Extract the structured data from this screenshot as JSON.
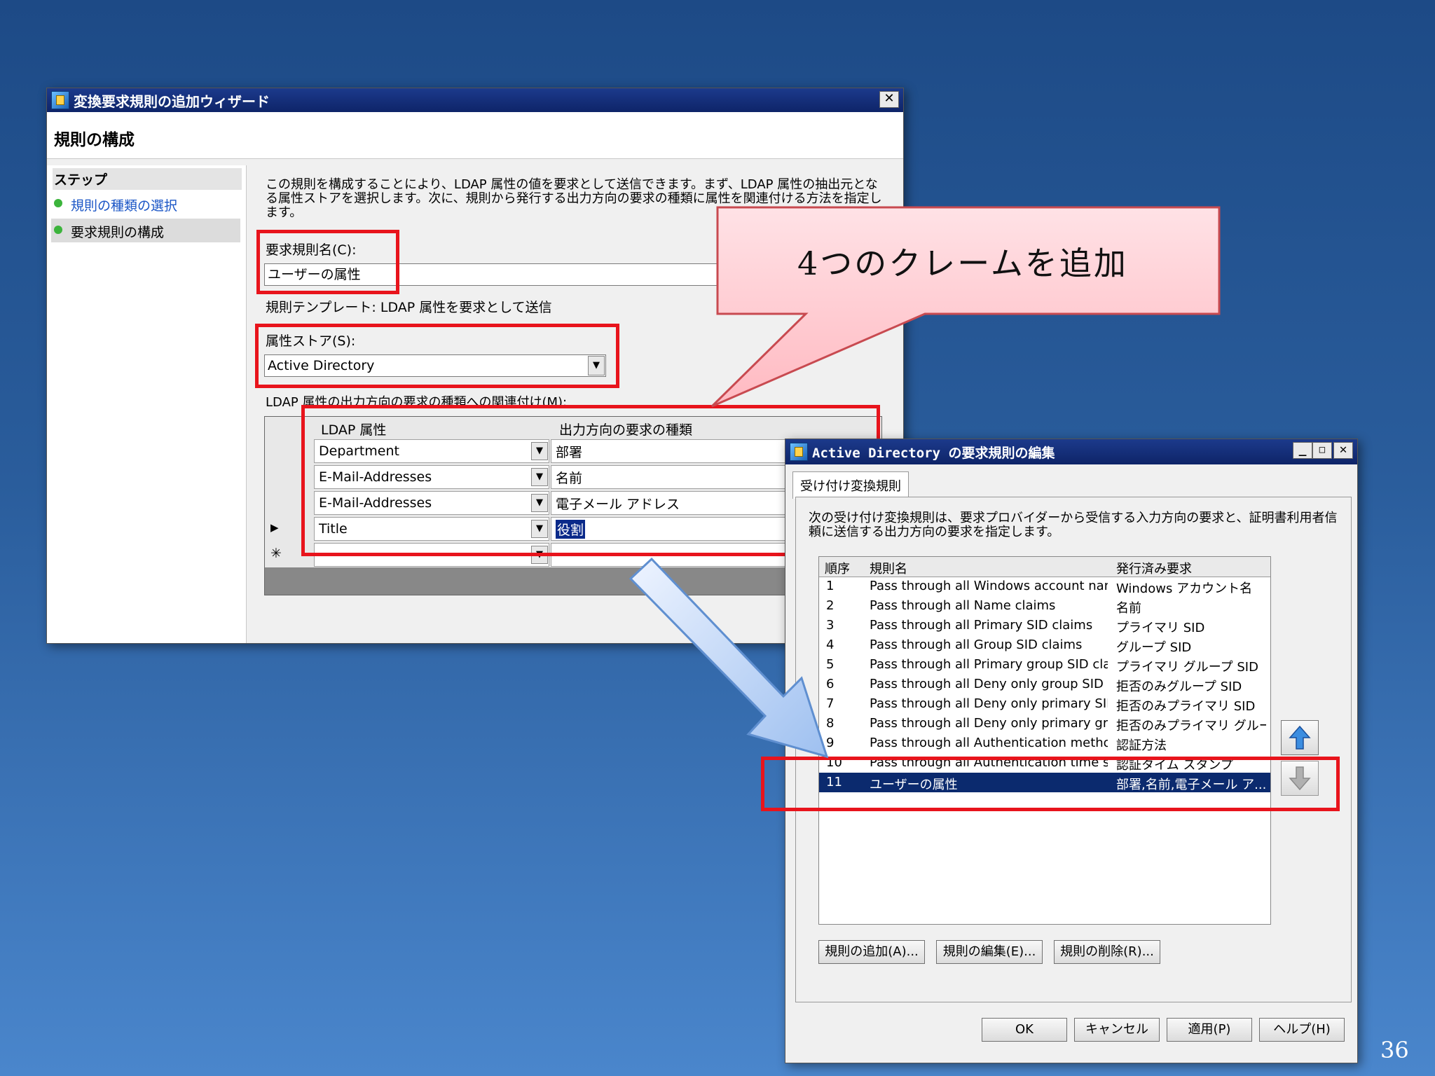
{
  "wizard": {
    "title": "変換要求規則の追加ウィザード",
    "heading": "規則の構成",
    "steps_label": "ステップ",
    "steps": [
      "規則の種類の選択",
      "要求規則の構成"
    ],
    "description": "この規則を構成することにより、LDAP 属性の値を要求として送信できます。まず、LDAP 属性の抽出元となる属性ストアを選択します。次に、規則から発行する出力方向の要求の種類に属性を関連付ける方法を指定します。",
    "rule_name_label": "要求規則名(C):",
    "rule_name_value": "ユーザーの属性",
    "template_text": "規則テンプレート: LDAP 属性を要求として送信",
    "store_label": "属性ストア(S):",
    "store_value": "Active Directory",
    "mapping_label": "LDAP 属性の出力方向の要求の種類への関連付け(M):",
    "col_ldap": "LDAP 属性",
    "col_claim": "出力方向の要求の種類",
    "rows": [
      {
        "marker": "",
        "ldap": "Department",
        "claim": "部署"
      },
      {
        "marker": "",
        "ldap": "E-Mail-Addresses",
        "claim": "名前"
      },
      {
        "marker": "",
        "ldap": "E-Mail-Addresses",
        "claim": "電子メール アドレス"
      },
      {
        "marker": "▶",
        "ldap": "Title",
        "claim": "役割"
      },
      {
        "marker": "✳",
        "ldap": "",
        "claim": ""
      }
    ]
  },
  "callout": {
    "text": "4つのクレームを追加"
  },
  "editor": {
    "title": "Active Directory の要求規則の編集",
    "tab": "受け付け変換規則",
    "description": "次の受け付け変換規則は、要求プロバイダーから受信する入力方向の要求と、証明書利用者信頼に送信する出力方向の要求を指定します。",
    "col_order": "順序",
    "col_name": "規則名",
    "col_issued": "発行済み要求",
    "rows": [
      {
        "order": "1",
        "name": "Pass through all Windows account name...",
        "issued": "Windows アカウント名"
      },
      {
        "order": "2",
        "name": "Pass through all Name claims",
        "issued": "名前"
      },
      {
        "order": "3",
        "name": "Pass through all Primary SID claims",
        "issued": "プライマリ SID"
      },
      {
        "order": "4",
        "name": "Pass through all Group SID claims",
        "issued": "グループ SID"
      },
      {
        "order": "5",
        "name": "Pass through all Primary group SID claims",
        "issued": "プライマリ グループ SID"
      },
      {
        "order": "6",
        "name": "Pass through all Deny only group SID cla...",
        "issued": "拒否のみグループ SID"
      },
      {
        "order": "7",
        "name": "Pass through all Deny only primary SID cl...",
        "issued": "拒否のみプライマリ SID"
      },
      {
        "order": "8",
        "name": "Pass through all Deny only primary group ...",
        "issued": "拒否のみプライマリ グルー..."
      },
      {
        "order": "9",
        "name": "Pass through all Authentication method c...",
        "issued": "認証方法"
      },
      {
        "order": "10",
        "name": "Pass through all Authentication time stam...",
        "issued": "認証タイム スタンプ"
      },
      {
        "order": "11",
        "name": "ユーザーの属性",
        "issued": "部署,名前,電子メール ア..."
      }
    ],
    "btn_add": "規則の追加(A)...",
    "btn_edit": "規則の編集(E)...",
    "btn_delete": "規則の削除(R)...",
    "btn_ok": "OK",
    "btn_cancel": "キャンセル",
    "btn_apply": "適用(P)",
    "btn_help": "ヘルプ(H)"
  },
  "slide_number": "36"
}
